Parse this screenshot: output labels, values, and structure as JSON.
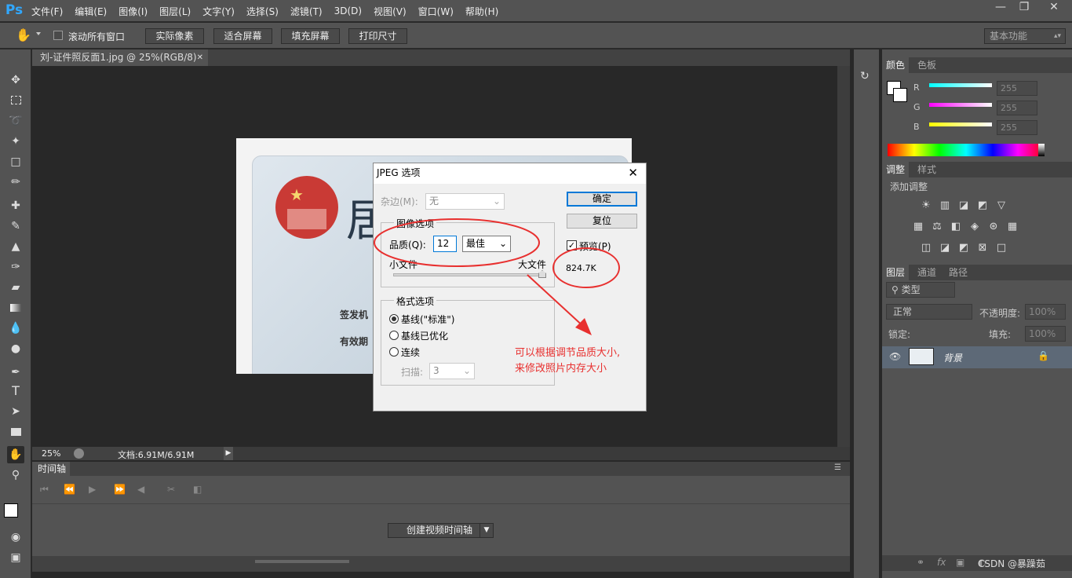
{
  "app": {
    "logo": "Ps"
  },
  "menu": [
    "文件(F)",
    "编辑(E)",
    "图像(I)",
    "图层(L)",
    "文字(Y)",
    "选择(S)",
    "滤镜(T)",
    "3D(D)",
    "视图(V)",
    "窗口(W)",
    "帮助(H)"
  ],
  "window_buttons": [
    "minimize-icon",
    "restore-icon",
    "close-icon"
  ],
  "options": {
    "scroll_all_label": "滚动所有窗口",
    "buttons": [
      "实际像素",
      "适合屏幕",
      "填充屏幕",
      "打印尺寸"
    ],
    "workspace": "基本功能"
  },
  "document": {
    "tab_title": "刘-证件照反面1.jpg @ 25%(RGB/8)",
    "zoom": "25%",
    "doc_size": "文档:6.91M/6.91M",
    "card_text": {
      "big_char": "居",
      "issuer": "签发机",
      "validity": "有效期"
    }
  },
  "timeline": {
    "title": "时间轴",
    "create_button": "创建视频时间轴"
  },
  "panels": {
    "color_tabs": [
      "颜色",
      "色板"
    ],
    "channels": [
      {
        "label": "R",
        "value": "255"
      },
      {
        "label": "G",
        "value": "255"
      },
      {
        "label": "B",
        "value": "255"
      }
    ],
    "adjust_tabs": [
      "调整",
      "样式"
    ],
    "adjust_title": "添加调整",
    "layers_tabs": [
      "图层",
      "通道",
      "路径"
    ],
    "layer_filter": "类型",
    "blend_mode": "正常",
    "opacity_label": "不透明度:",
    "opacity_value": "100%",
    "lock_label": "锁定:",
    "fill_label": "填充:",
    "fill_value": "100%",
    "layer_name": "背景"
  },
  "dialog": {
    "title": "JPEG 选项",
    "matte_label": "杂边(M):",
    "matte_value": "无",
    "image_options_legend": "图像选项",
    "quality_label": "品质(Q):",
    "quality_value": "12",
    "quality_preset": "最佳",
    "small_file": "小文件",
    "large_file": "大文件",
    "quality_level": 1.0,
    "format_legend": "格式选项",
    "format_options": [
      "基线(\"标准\")",
      "基线已优化",
      "连续"
    ],
    "selected_format": 0,
    "scans_label": "扫描:",
    "scans_value": "3",
    "ok": "确定",
    "reset": "复位",
    "preview_label": "预览(P)",
    "preview_checked": true,
    "file_size": "824.7K"
  },
  "annotation": {
    "line1": "可以根据调节品质大小,",
    "line2": "来修改照片内存大小",
    "color": "#e8302f"
  },
  "watermark": "CSDN @暴躁茹"
}
